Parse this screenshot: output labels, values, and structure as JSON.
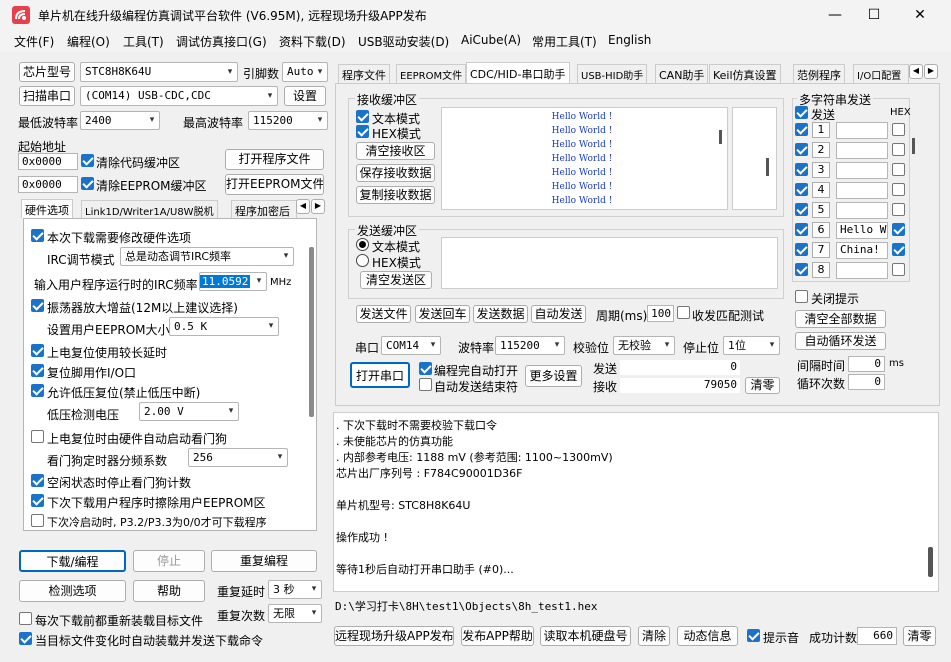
{
  "window": {
    "title": "单片机在线升级编程仿真调试平台软件 (V6.95M), 远程现场升级APP发布",
    "min": "—",
    "max": "☐",
    "close": "✕"
  },
  "menu": [
    "文件(F)",
    "编程(O)",
    "工具(T)",
    "调试仿真接口(G)",
    "资料下载(D)",
    "USB驱动安装(D)",
    "AiCube(A)",
    "常用工具(T)",
    "English"
  ],
  "left": {
    "chip_label": "芯片型号",
    "chip_value": "STC8H8K64U",
    "pins_label": "引脚数",
    "pins_value": "Auto",
    "scan_btn": "扫描串口",
    "port_value": "(COM14) USB-CDC,CDC",
    "settings_btn": "设置",
    "min_baud_label": "最低波特率",
    "min_baud_value": "2400",
    "max_baud_label": "最高波特率",
    "max_baud_value": "115200",
    "start_addr_label": "起始地址",
    "addr1": "0x0000",
    "clear_code": "清除代码缓冲区",
    "open_prog_btn": "打开程序文件",
    "addr2": "0x0000",
    "clear_eeprom": "清除EEPROM缓冲区",
    "open_eeprom_btn": "打开EEPROM文件",
    "tabs": [
      "硬件选项",
      "Link1D/Writer1A/U8W脱机",
      "程序加密后"
    ],
    "hw": {
      "opt1": "本次下载需要修改硬件选项",
      "irc_mode_label": "IRC调节模式",
      "irc_mode_value": "总是动态调节IRC频率",
      "irc_freq_label": "输入用户程序运行时的IRC频率",
      "irc_freq_value": "11.0592",
      "irc_unit": "MHz",
      "opt_osc": "振荡器放大增益(12M以上建议选择)",
      "eeprom_size_label": "设置用户EEPROM大小",
      "eeprom_size_value": "0.5 K",
      "opt_delay": "上电复位使用较长延时",
      "opt_reset": "复位脚用作I/O口",
      "opt_lvr": "允许低压复位(禁止低压中断)",
      "lvd_label": "低压检测电压",
      "lvd_value": "2.00 V",
      "opt_wdt": "上电复位时由硬件自动启动看门狗",
      "wdt_label": "看门狗定时器分频系数",
      "wdt_value": "256",
      "opt_idle": "空闲状态时停止看门狗计数",
      "opt_erase": "下次下载用户程序时擦除用户EEPROM区",
      "opt_p32": "下次冷启动时, P3.2/P3.3为0/0才可下载程序"
    },
    "download_btn": "下载/编程",
    "stop_btn": "停止",
    "repeat_btn": "重复编程",
    "check_btn": "检测选项",
    "help_btn": "帮助",
    "repeat_delay_label": "重复延时",
    "repeat_delay_value": "3 秒",
    "repeat_count_label": "重复次数",
    "repeat_count_value": "无限",
    "reload_each": "每次下载前都重新装载目标文件",
    "auto_load": "当目标文件变化时自动装载并发送下载命令"
  },
  "right": {
    "tabs": [
      "程序文件",
      "EEPROM文件",
      "CDC/HID-串口助手",
      "USB-HID助手",
      "CAN助手",
      "Keil仿真设置",
      "范例程序",
      "I/O口配置"
    ],
    "rx_group": "接收缓冲区",
    "rx_text": "文本模式",
    "rx_hex": "HEX模式",
    "rx_clear": "清空接收区",
    "rx_save": "保存接收数据",
    "rx_copy": "复制接收数据",
    "rx_lines": [
      "Hello World !",
      "Hello World !",
      "Hello World !",
      "Hello World !",
      "Hello World !",
      "Hello World !",
      "Hello World !",
      "Hello World !"
    ],
    "tx_group": "发送缓冲区",
    "tx_text": "文本模式",
    "tx_hex": "HEX模式",
    "tx_clear": "清空发送区",
    "send_file": "发送文件",
    "send_back": "发送回车",
    "send_data": "发送数据",
    "auto_send": "自动发送",
    "period_label": "周期(ms)",
    "period_value": "100",
    "match_test": "收发匹配测试",
    "multi_group": "多字符串发送",
    "multi_send": "发送",
    "multi_hex": "HEX",
    "multi_rows": [
      {
        "n": "1",
        "text": ""
      },
      {
        "n": "2",
        "text": ""
      },
      {
        "n": "3",
        "text": ""
      },
      {
        "n": "4",
        "text": ""
      },
      {
        "n": "5",
        "text": ""
      },
      {
        "n": "6",
        "text": "Hello Wo"
      },
      {
        "n": "7",
        "text": "China!"
      },
      {
        "n": "8",
        "text": ""
      }
    ],
    "close_tip": "关闭提示",
    "clear_all": "清空全部数据",
    "auto_loop": "自动循环发送",
    "interval_label": "间隔时间",
    "interval_value": "0",
    "interval_unit": "ms",
    "loop_label": "循环次数",
    "loop_value": "0",
    "port_label": "串口",
    "port_value": "COM14",
    "baud_label": "波特率",
    "baud_value": "115200",
    "parity_label": "校验位",
    "parity_value": "无校验",
    "stop_label": "停止位",
    "stop_value": "1位",
    "open_port": "打开串口",
    "auto_open": "编程完自动打开",
    "auto_end": "自动发送结束符",
    "more_settings": "更多设置",
    "send_label": "发送",
    "send_count": "0",
    "recv_label": "接收",
    "recv_count": "79050",
    "clear_count": "清零",
    "log": [
      ". 下次下载时不需要校验下载口令",
      ". 未使能芯片的仿真功能",
      ". 内部参考电压: 1188 mV (参考范围: 1100~1300mV)",
      "芯片出厂序列号 : F784C90001D36F",
      "",
      "  单片机型号: STC8H8K64U",
      "",
      "操作成功 !",
      "",
      "等待1秒后自动打开串口助手 (#0)..."
    ],
    "file_path": "D:\\学习打卡\\8H\\test1\\Objects\\8h_test1.hex",
    "bottom": {
      "publish": "远程现场升级APP发布",
      "publish_help": "发布APP帮助",
      "read_disk": "读取本机硬盘号",
      "clear": "清除",
      "animate": "动态信息",
      "sound": "提示音",
      "success_label": "成功计数",
      "success_value": "660",
      "clear2": "清零"
    }
  }
}
